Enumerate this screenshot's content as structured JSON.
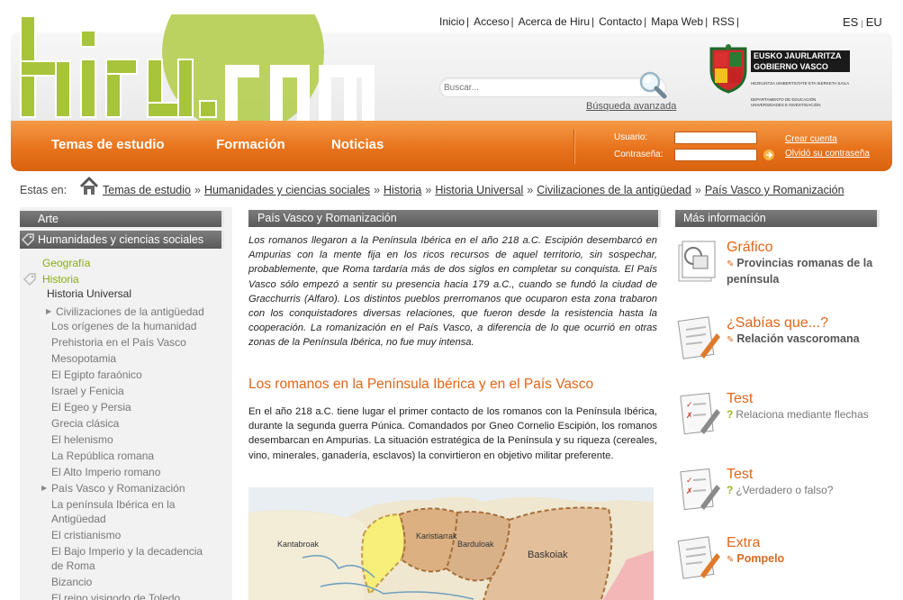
{
  "header": {
    "logo_text": "hiru.com",
    "top_nav": [
      "Inicio",
      "Acceso",
      "Acerca de Hiru",
      "Contacto",
      "Mapa Web",
      "RSS"
    ],
    "languages": [
      "ES",
      "EU"
    ],
    "search_placeholder": "Buscar...",
    "advanced_search": "Búsqueda avanzada",
    "gov": {
      "line1": "EUSKO JAURLARITZA",
      "line2": "GOBIERNO VASCO",
      "line3": "HEZKUNTZA UNIBERTSITATE ETA IKERKETA SAILA",
      "line4": "DEPARTAMENTO DE EDUCACIÓN UNIVERSIDADES E INVESTIGACIÓN"
    }
  },
  "main_nav": [
    "Temas de estudio",
    "Formación",
    "Noticias"
  ],
  "login": {
    "user_label": "Usuario:",
    "pass_label": "Contraseña:",
    "create_account": "Crear cuenta",
    "forgot_password": "Olvidó su contraseña"
  },
  "breadcrumb": {
    "label": "Estas en:",
    "items": [
      "Temas de estudio",
      "Humanidades y ciencias sociales",
      "Historia",
      "Historia Universal",
      "Civilizaciones de la antigüedad",
      "País Vasco y Romanización"
    ]
  },
  "sidebar": {
    "arte": "Arte",
    "humanidades": "Humanidades y ciencias sociales",
    "geografia": "Geografía",
    "historia": "Historia",
    "historia_universal": "Historia Universal",
    "civilizaciones": "Civilizaciones de la antigüedad",
    "items": [
      "Los orígenes de la humanidad",
      "Prehistoria en el País Vasco",
      "Mesopotamia",
      "El Egipto faraónico",
      "Israel y Fenicia",
      "El Egeo y Persia",
      "Grecia clásica",
      "El helenismo",
      "La República romana",
      "El Alto Imperio romano"
    ],
    "current": "País Vasco y Romanización",
    "sub_items": [
      "La península Ibérica en la",
      "Antigüedad",
      "El cristianismo",
      "El Bajo Imperio y la decadencia",
      "de Roma",
      "Bizancio",
      "El reino visigodo de Toledo"
    ]
  },
  "main": {
    "heading": "País Vasco y Romanización",
    "intro": "Los romanos llegaron a la Península Ibérica en el año 218 a.C. Escipión desembarcó en Ampurias con la mente fija en los ricos recursos de aquel territorio, sin sospechar, probablemente, que Roma tardaría más de dos siglos en completar su conquista. El País Vasco sólo empezó a sentir su presencia hacia 179 a.C., cuando se fundó la ciudad de Gracchurris (Alfaro). Los distintos pueblos prerromanos que ocuparon esta zona trabaron con los conquistadores diversas relaciones, que fueron desde la resistencia hasta la cooperación. La romanización en el País Vasco, a diferencia de lo que ocurrió en otras zonas de la Península Ibérica, no fue muy intensa.",
    "section_title": "Los romanos en la Península Ibérica y en el País Vasco",
    "body": "En el año 218 a.C. tiene lugar el primer contacto de los romanos con la Península Ibérica, durante la segunda guerra Púnica. Comandados por Gneo Cornelio Escipión, los romanos desembarcan en Ampurias. La situación estratégica de la Península y su riqueza (cereales, vino, minerales, ganadería, esclavos) la convirtieron en objetivo militar preferente.",
    "map_labels": [
      "Kantabroak",
      "Karistiarrak",
      "Barduloak",
      "Baskoiak"
    ]
  },
  "right": {
    "heading": "Más información",
    "resources": [
      {
        "type": "Gráfico",
        "desc": "Provincias romanas de la península"
      },
      {
        "type": "¿Sabías que...?",
        "desc": "Relación vascoromana"
      },
      {
        "type": "Test",
        "desc": "Relaciona mediante flechas"
      },
      {
        "type": "Test",
        "desc": "¿Verdadero o falso?"
      },
      {
        "type": "Extra",
        "desc": "Pompelo"
      }
    ]
  },
  "colors": {
    "accent_orange": "#e8731c",
    "logo_green": "#a8c43a",
    "link_orange": "#e0661a",
    "sidebar_green": "#8aaa1a"
  }
}
